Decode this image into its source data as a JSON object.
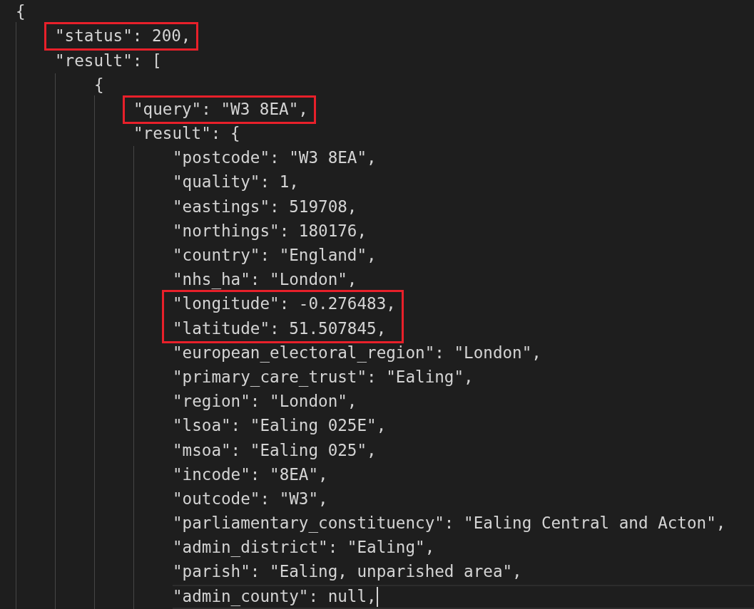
{
  "editor": {
    "lines": [
      {
        "text": "{",
        "boxed": false,
        "current": false,
        "children": [
          {
            "text": "\"status\": 200,",
            "boxed": true,
            "current": false
          },
          {
            "text": "\"result\": [",
            "boxed": false,
            "current": false,
            "children": [
              {
                "text": "{",
                "boxed": false,
                "current": false,
                "children": [
                  {
                    "text": "\"query\": \"W3 8EA\",",
                    "boxed": true,
                    "current": false
                  },
                  {
                    "text": "\"result\": {",
                    "boxed": false,
                    "current": false,
                    "children": [
                      {
                        "text": "\"postcode\": \"W3 8EA\",",
                        "boxed": false,
                        "current": false
                      },
                      {
                        "text": "\"quality\": 1,",
                        "boxed": false,
                        "current": false
                      },
                      {
                        "text": "\"eastings\": 519708,",
                        "boxed": false,
                        "current": false
                      },
                      {
                        "text": "\"northings\": 180176,",
                        "boxed": false,
                        "current": false
                      },
                      {
                        "text": "\"country\": \"England\",",
                        "boxed": false,
                        "current": false
                      },
                      {
                        "text": "\"nhs_ha\": \"London\",",
                        "boxed": false,
                        "current": false
                      },
                      {
                        "text": "\"longitude\": -0.276483,",
                        "boxed": true,
                        "current": false
                      },
                      {
                        "text": "\"latitude\": 51.507845,",
                        "boxed": true,
                        "current": false
                      },
                      {
                        "text": "\"european_electoral_region\": \"London\",",
                        "boxed": false,
                        "current": false
                      },
                      {
                        "text": "\"primary_care_trust\": \"Ealing\",",
                        "boxed": false,
                        "current": false
                      },
                      {
                        "text": "\"region\": \"London\",",
                        "boxed": false,
                        "current": false
                      },
                      {
                        "text": "\"lsoa\": \"Ealing 025E\",",
                        "boxed": false,
                        "current": false
                      },
                      {
                        "text": "\"msoa\": \"Ealing 025\",",
                        "boxed": false,
                        "current": false
                      },
                      {
                        "text": "\"incode\": \"8EA\",",
                        "boxed": false,
                        "current": false
                      },
                      {
                        "text": "\"outcode\": \"W3\",",
                        "boxed": false,
                        "current": false
                      },
                      {
                        "text": "\"parliamentary_constituency\": \"Ealing Central and Acton\",",
                        "boxed": false,
                        "current": false
                      },
                      {
                        "text": "\"admin_district\": \"Ealing\",",
                        "boxed": false,
                        "current": false
                      },
                      {
                        "text": "\"parish\": \"Ealing, unparished area\",",
                        "boxed": false,
                        "current": false
                      },
                      {
                        "text": "\"admin_county\": null,",
                        "boxed": false,
                        "current": true
                      }
                    ]
                  }
                ]
              }
            ]
          }
        ]
      }
    ]
  }
}
